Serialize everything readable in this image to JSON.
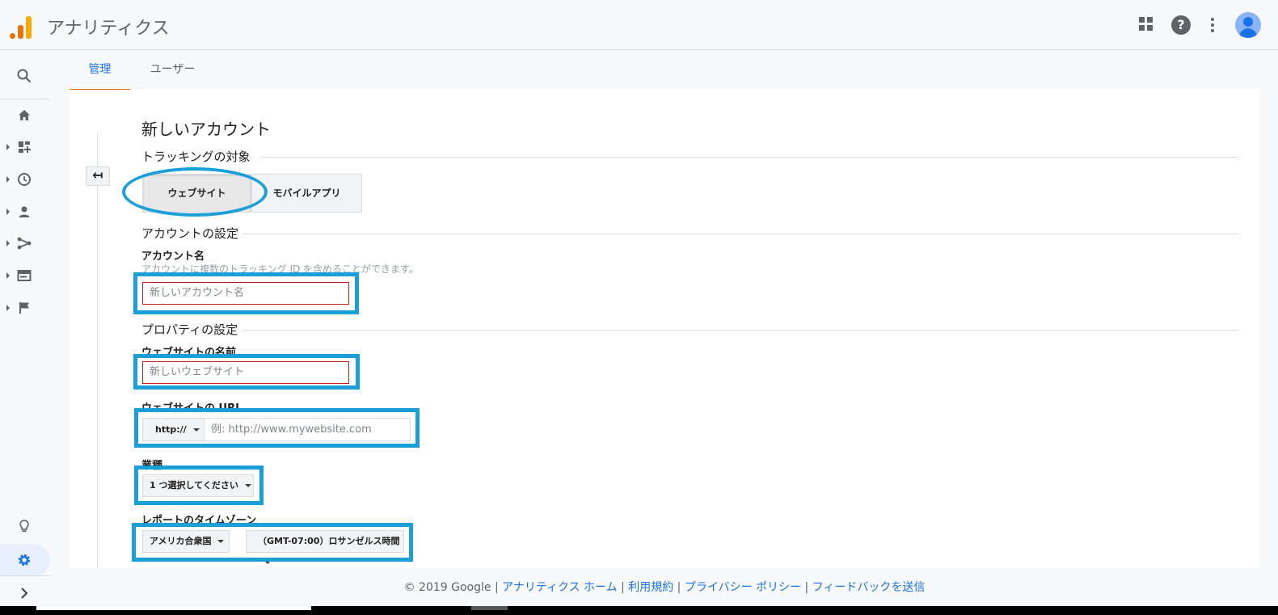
{
  "header": {
    "app_title": "アナリティクス",
    "help_glyph": "?"
  },
  "tabs": [
    {
      "label": "管理"
    },
    {
      "label": "ユーザー"
    }
  ],
  "form": {
    "page_title": "新しいアカウント",
    "tracking_section": "トラッキングの対象",
    "tracking_options": [
      "ウェブサイト",
      "モバイルアプリ"
    ],
    "back_glyph": "↤",
    "account_section": "アカウントの設定",
    "account_name_label": "アカウント名",
    "account_name_help": "アカウントに複数のトラッキング ID を含めることができます。",
    "account_name_placeholder": "新しいアカウント名",
    "property_section": "プロパティの設定",
    "website_name_label": "ウェブサイトの名前",
    "website_name_placeholder": "新しいウェブサイト",
    "website_url_label": "ウェブサイトの URL",
    "url_protocol": "http://",
    "url_placeholder": "例: http://www.mywebsite.com",
    "industry_label": "業種",
    "industry_select": "1 つ選択してください",
    "timezone_label": "レポートのタイムゾーン",
    "country_select": "アメリカ合衆国",
    "timezone_select": "（GMT-07:00）ロサンゼルス時間"
  },
  "footer": {
    "copyright": "© 2019 Google | ",
    "links": [
      "アナリティクス ホーム",
      "利用規約",
      "プライバシー ポリシー",
      "フィードバックを送信"
    ],
    "separator": " | "
  },
  "nav_icons": [
    "search-icon",
    "home-icon",
    "customization-icon",
    "realtime-icon",
    "audience-icon",
    "acquisition-icon",
    "behavior-icon",
    "conversions-icon",
    "discover-icon",
    "admin-gear-icon",
    "expand-icon"
  ],
  "colors": {
    "accent": "#1a73e8",
    "tab_underline": "#e8710a",
    "highlight_annotation": "#1a9fd9",
    "input_error_border": "#c5221f"
  }
}
